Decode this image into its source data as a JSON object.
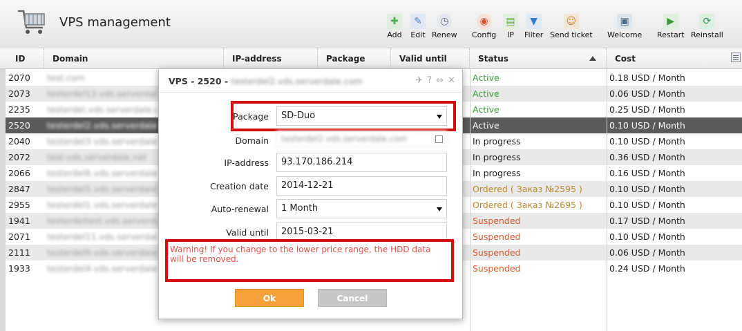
{
  "page": {
    "title": "VPS management"
  },
  "toolbar": [
    {
      "label": "Add",
      "icon": "add-icon",
      "color": "#4caf50"
    },
    {
      "label": "Edit",
      "icon": "edit-icon",
      "color": "#5a7fb5"
    },
    {
      "label": "Renew",
      "icon": "renew-icon",
      "color": "#607080"
    },
    {
      "label": "Config",
      "icon": "config-icon",
      "color": "#d84f2a"
    },
    {
      "label": "IP",
      "icon": "ip-icon",
      "color": "#6aa84f"
    },
    {
      "label": "Filter",
      "icon": "filter-icon",
      "color": "#3b7dc4"
    },
    {
      "label": "Send ticket",
      "icon": "send-ticket-icon",
      "color": "#c9872f"
    },
    {
      "label": "Welcome",
      "icon": "welcome-icon",
      "color": "#4a6b8a"
    },
    {
      "label": "Restart",
      "icon": "restart-icon",
      "color": "#3c9a3c"
    },
    {
      "label": "Reinstall",
      "icon": "reinstall-icon",
      "color": "#2f8f4f"
    }
  ],
  "table": {
    "columns": [
      "ID",
      "Domain",
      "IP-address",
      "Package",
      "Valid until",
      "Status",
      "Cost"
    ],
    "rows": [
      {
        "id": "2070",
        "domain": "test.com",
        "status": "Active",
        "status_kind": "active",
        "cost": "0.18 USD / Month"
      },
      {
        "id": "2073",
        "domain": "testerdel13.vds.serverdale.com",
        "status": "Active",
        "status_kind": "active",
        "cost": "0.06 USD / Month"
      },
      {
        "id": "2235",
        "domain": "testerdel.vds.serverdale.com",
        "status": "Active",
        "status_kind": "active",
        "cost": "0.25 USD / Month"
      },
      {
        "id": "2520",
        "domain": "testerdel2.vds.serverdale.com",
        "status": "Active",
        "status_kind": "active",
        "cost": "0.10 USD / Month",
        "selected": true
      },
      {
        "id": "2040",
        "domain": "testerdel3.vds.serverdale.com",
        "status": "In progress",
        "status_kind": "progress",
        "cost": "0.10 USD / Month"
      },
      {
        "id": "2072",
        "domain": "test-vds.serverdale.net",
        "status": "In progress",
        "status_kind": "progress",
        "cost": "0.36 USD / Month"
      },
      {
        "id": "2066",
        "domain": "testerdel6.vds.serverdale.com",
        "status": "In progress",
        "status_kind": "progress",
        "cost": "0.16 USD / Month"
      },
      {
        "id": "2847",
        "domain": "testerdel5.vds.serverdale.com",
        "status": "Ordered ( Заказ №2595 )",
        "status_kind": "ordered",
        "cost": "0.10 USD / Month"
      },
      {
        "id": "2955",
        "domain": "testerdel1.vds.serverdale.com",
        "status": "Ordered ( Заказ №2695 )",
        "status_kind": "ordered",
        "cost": "0.10 USD / Month"
      },
      {
        "id": "1941",
        "domain": "testerdeltest.vds.serverdale",
        "status": "Suspended",
        "status_kind": "suspended",
        "cost": "0.17 USD / Month"
      },
      {
        "id": "2071",
        "domain": "testerdel11.vds.serverdale",
        "status": "Suspended",
        "status_kind": "suspended",
        "cost": "0.10 USD / Month"
      },
      {
        "id": "2111",
        "domain": "testerdel9.vds.serverdale.com",
        "status": "Suspended",
        "status_kind": "suspended",
        "cost": "0.06 USD / Month"
      },
      {
        "id": "1933",
        "domain": "testerdel4.vds.serverdale.com",
        "status": "Suspended",
        "status_kind": "suspended",
        "cost": "0.24 USD / Month"
      }
    ]
  },
  "modal": {
    "title": "VPS - 2520 -",
    "title_domain": "testerdel2.vds.serverdale.com",
    "fields": {
      "package": {
        "label": "Package",
        "value": "SD-Duo"
      },
      "domain": {
        "label": "Domain",
        "value": "testerdel2.vds.serverdale.com"
      },
      "ip": {
        "label": "IP-address",
        "value": "93.170.186.214"
      },
      "created": {
        "label": "Creation date",
        "value": "2014-12-21"
      },
      "renewal": {
        "label": "Auto-renewal",
        "value": "1 Month"
      },
      "valid": {
        "label": "Valid until",
        "value": "2015-03-21"
      }
    },
    "warning": "Warning! If you change to the lower price range, the HDD data will be removed.",
    "ok_label": "Ok",
    "cancel_label": "Cancel"
  },
  "colors": {
    "accent_ok": "#f6a23c",
    "highlight": "#d10f0f",
    "active": "#3c9a3c",
    "ordered": "#b58a2c",
    "suspended": "#d35b2b"
  }
}
